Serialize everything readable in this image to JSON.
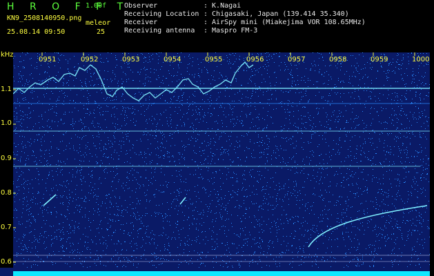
{
  "header": {
    "logo": "H R O F F T",
    "version": "1.00f",
    "filename": "KN9_2508140950.png",
    "mode": "meleor",
    "datetime": "25.08.14 09:50",
    "count": "25",
    "fields": [
      {
        "label": "Observer",
        "value": ": K.Nagai"
      },
      {
        "label": "Receiving Location",
        "value": ": Chigasaki, Japan (139.414 35.340)"
      },
      {
        "label": "Receiver",
        "value": ": AirSpy mini (Miakejima VOR 108.65MHz)"
      },
      {
        "label": "Receiving antenna",
        "value": ": Maspro FM-3"
      }
    ]
  },
  "axis": {
    "unit": "kHz",
    "y_ticks": [
      "1.1",
      "1.0",
      "0.9",
      "0.8",
      "0.7",
      "0.6"
    ],
    "time_ticks": [
      "0951",
      "0952",
      "0953",
      "0954",
      "0955",
      "0956",
      "0957",
      "0958",
      "0959",
      "1000"
    ]
  },
  "colors": {
    "background": "#0a1a66",
    "noise": "#2a8cff",
    "signal": "#7ff0ff",
    "label": "#ffff40",
    "accent": "#5cff3c"
  }
}
